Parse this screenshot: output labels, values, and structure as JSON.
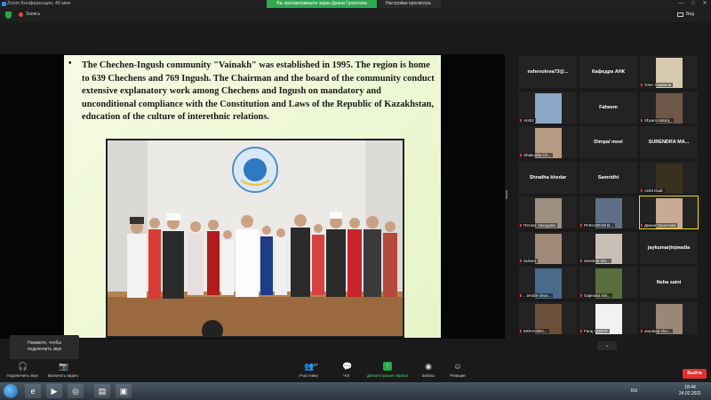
{
  "window": {
    "title": "Zoom Конференция, 40 мин",
    "share_banner": "Вы просматриваете экран Диана Грохотова",
    "share_settings": "Настройки просмотра",
    "controls": [
      "—",
      "□",
      "✕"
    ]
  },
  "top_bar": {
    "recording_label": "Запись",
    "view_label": "Вид"
  },
  "slide": {
    "bullet": "•",
    "text": "The Chechen-Ingush community \"Vainakh\" was established in 1995. The region is home to 639 Chechens and 769 Ingush. The Chairman and the board of the community conduct extensive explanatory work among Chechens and Ingush on mandatory and unconditional compliance with the Constitution and Laws of the Republic of Kazakhstan, education of the culture of interethnic relations."
  },
  "gallery": {
    "tiles": [
      {
        "name": "nshevoleva73@...",
        "style": "center"
      },
      {
        "name": "Кафедра АНК",
        "style": "center"
      },
      {
        "name": "Олег Семёнов",
        "style": "small",
        "video": true,
        "bg": "#d6c9b0"
      },
      {
        "name": "Arsh2",
        "style": "small",
        "video": true,
        "bg": "#8aa8c6"
      },
      {
        "name": "Faheem",
        "style": "center"
      },
      {
        "name": "Shyam Indora_",
        "style": "small",
        "video": true,
        "bg": "#6f5848"
      },
      {
        "name": "Shakuntla Ch...",
        "style": "small",
        "video": true,
        "bg": "#b79a82"
      },
      {
        "name": "Dimpal meel",
        "style": "center"
      },
      {
        "name": "SURENDRA MA...",
        "style": "center"
      },
      {
        "name": "Shradha khedar",
        "style": "center"
      },
      {
        "name": "Samridhi",
        "style": "center"
      },
      {
        "name": "Ankit Dudi",
        "style": "small",
        "video": true,
        "bg": "#3a3020"
      },
      {
        "name": "Петнат Авхадова",
        "style": "small",
        "video": true,
        "bg": "#9c8f80"
      },
      {
        "name": "PARASRAM B...",
        "style": "small",
        "video": true,
        "bg": "#5f6f88"
      },
      {
        "name": "Диана Грохотова",
        "style": "small",
        "video": true,
        "bg": "#c7a996",
        "active": true
      },
      {
        "name": "Suhani",
        "style": "small",
        "video": true,
        "bg": "#a08a78"
      },
      {
        "name": "Sanskriti Ver...",
        "style": "small",
        "video": true,
        "bg": "#c8c0b6"
      },
      {
        "name": "jaykumarjinjwadia",
        "style": "center"
      },
      {
        "name": "...tendre chou...",
        "style": "small",
        "video": true,
        "bg": "#4a6a8c"
      },
      {
        "name": "Gajendra Sin...",
        "style": "small",
        "video": true,
        "bg": "#5a6e3c"
      },
      {
        "name": "Neha saini",
        "style": "center"
      },
      {
        "name": "MOHANRA...",
        "style": "small",
        "video": true,
        "bg": "#6b4f3a"
      },
      {
        "name": "Faraj QURAT",
        "style": "small",
        "video": true,
        "bg": "#f2f2f2"
      },
      {
        "name": "sandeep cho...",
        "style": "small",
        "video": true,
        "bg": "#9a8876"
      }
    ],
    "scroll_label": "⌄"
  },
  "tooltip": {
    "line1": "Нажмите, чтобы",
    "line2": "подключить звук"
  },
  "toolbar": {
    "audio_label": "Подключить звук",
    "video_label": "Включить видео",
    "participants_label": "Участники",
    "participants_count": "87",
    "chat_label": "Чат",
    "share_label": "Демонстрация экрана",
    "record_label": "Запись",
    "reactions_label": "Реакции",
    "leave_label": "Выйти"
  },
  "taskbar": {
    "lang": "RU",
    "time": "18:44",
    "date": "24.02.2021"
  },
  "colors": {
    "accent_green": "#28a745",
    "leave_red": "#e0322d",
    "active_speaker": "#f5e000",
    "slide_bg": "#eef7d4"
  }
}
